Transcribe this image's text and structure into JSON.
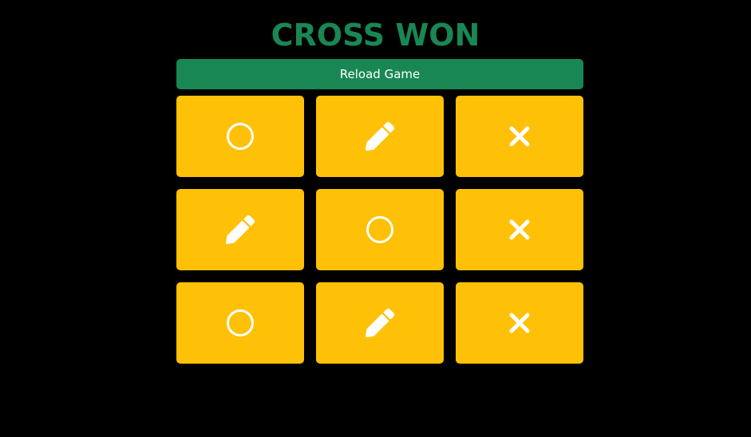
{
  "game": {
    "status_text": "CROSS WON",
    "reload_label": "Reload Game"
  },
  "colors": {
    "background": "#000000",
    "title": "#198754",
    "button": "#198754",
    "button_text": "#ffffff",
    "cell": "#ffc107",
    "icon": "#ffffff"
  },
  "board": {
    "cells": [
      {
        "mark": "circle-icon"
      },
      {
        "mark": "pencil-icon"
      },
      {
        "mark": "cross-icon"
      },
      {
        "mark": "pencil-icon"
      },
      {
        "mark": "circle-icon"
      },
      {
        "mark": "cross-icon"
      },
      {
        "mark": "circle-icon"
      },
      {
        "mark": "pencil-icon"
      },
      {
        "mark": "cross-icon"
      }
    ]
  }
}
